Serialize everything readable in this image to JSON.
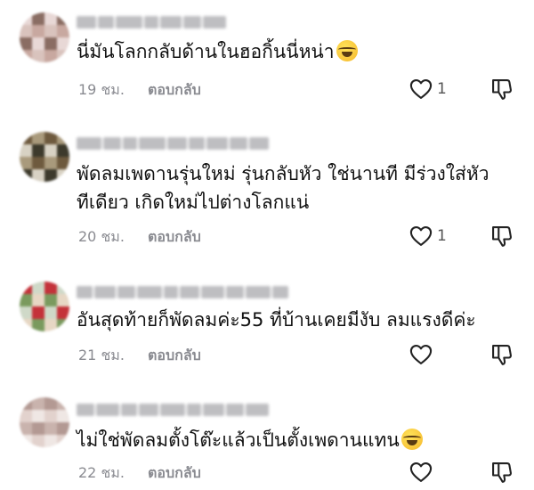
{
  "comments": [
    {
      "text": "นี่มันโลกกลับด้านในฮอกิ้นนี่หน่า",
      "emoji": "face-with-tears-of-joy",
      "time": "19 ชม.",
      "reply_label": "ตอบกลับ",
      "like_count": "1",
      "avatar_colors": [
        "#e8d8d6",
        "#c8a8a0",
        "#8a6d63",
        "#d9c3bd"
      ]
    },
    {
      "text": "พัดลมเพดานรุ่นใหม่ รุ่นกลับหัว ใช่นานที มีร่วงใส่หัว\nทีเดียว เกิดใหม่ไปต่างโลกแน่",
      "emoji": "",
      "time": "20 ชม.",
      "reply_label": "ตอบกลับ",
      "like_count": "1",
      "avatar_colors": [
        "#d8d2c4",
        "#6e5a3e",
        "#3d3a2c",
        "#a99a7c"
      ]
    },
    {
      "text": "อันสุดท้ายก็พัดลมค่ะ55 ที่บ้านเคยมีงับ ลมแรงดีค่ะ",
      "emoji": "",
      "time": "21 ชม.",
      "reply_label": "ตอบกลับ",
      "like_count": "",
      "avatar_colors": [
        "#cfd9c8",
        "#7a9a5e",
        "#c4323a",
        "#e7d7c4"
      ]
    },
    {
      "text": "ไม่ใช่พัดลมตั้งโต๊ะแล้วเป็นตั้งเพดานแทน",
      "emoji": "face-with-tears-of-joy",
      "time": "22 ชม.",
      "reply_label": "ตอบกลับ",
      "like_count": "",
      "avatar_colors": [
        "#efe7e4",
        "#c9b3ad",
        "#e2d2cd",
        "#b39993"
      ]
    }
  ]
}
